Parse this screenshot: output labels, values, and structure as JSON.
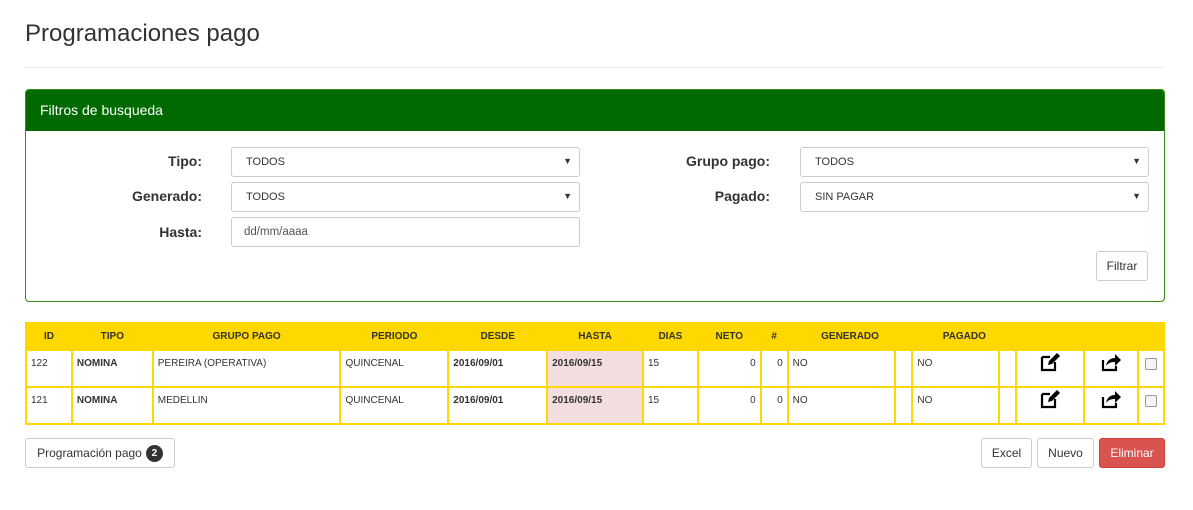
{
  "page": {
    "title": "Programaciones pago"
  },
  "filters": {
    "heading": "Filtros de busqueda",
    "tipo_label": "Tipo:",
    "tipo_value": "TODOS",
    "generado_label": "Generado:",
    "generado_value": "TODOS",
    "hasta_label": "Hasta:",
    "hasta_placeholder": "dd/mm/aaaa",
    "grupo_label": "Grupo pago:",
    "grupo_value": "TODOS",
    "pagado_label": "Pagado:",
    "pagado_value": "SIN PAGAR",
    "filter_button": "Filtrar"
  },
  "table": {
    "headers": [
      "ID",
      "TIPO",
      "GRUPO PAGO",
      "PERIODO",
      "DESDE",
      "HASTA",
      "DIAS",
      "NETO",
      "#",
      "GENERADO",
      "PAGADO"
    ],
    "rows": [
      {
        "id": "122",
        "tipo": "NOMINA",
        "grupo": "PEREIRA (OPERATIVA)",
        "periodo": "QUINCENAL",
        "desde": "2016/09/01",
        "hasta": "2016/09/15",
        "dias": "15",
        "neto": "0",
        "num": "0",
        "generado": "NO",
        "pagado": "NO"
      },
      {
        "id": "121",
        "tipo": "NOMINA",
        "grupo": "MEDELLIN",
        "periodo": "QUINCENAL",
        "desde": "2016/09/01",
        "hasta": "2016/09/15",
        "dias": "15",
        "neto": "0",
        "num": "0",
        "generado": "NO",
        "pagado": "NO"
      }
    ]
  },
  "footer": {
    "count_button": "Programación pago",
    "count_badge": "2",
    "excel": "Excel",
    "nuevo": "Nuevo",
    "eliminar": "Eliminar"
  },
  "icons": {
    "edit": "edit-icon",
    "share": "share-icon",
    "caret": "caret-down-icon"
  },
  "colors": {
    "panel_heading": "#006a00",
    "table_header": "#ffd800",
    "hasta_cell": "#f2dede",
    "danger": "#d9534f"
  }
}
